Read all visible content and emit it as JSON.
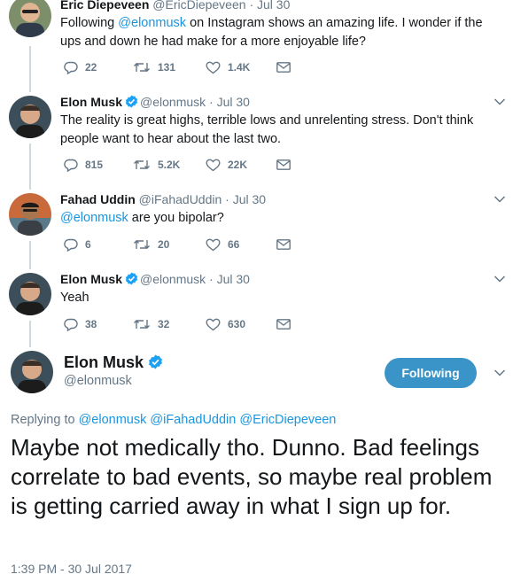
{
  "tweets": [
    {
      "name": "Eric Diepeveen",
      "handle": "@EricDiepeveen",
      "sep": "·",
      "date": "Jul 30",
      "text_before": "Following ",
      "text_mention": "@elonmusk",
      "text_after": " on Instagram shows an amazing life. I wonder if the ups and down he had make for a more enjoyable life?",
      "replies": "22",
      "retweets": "131",
      "likes": "1.4K"
    },
    {
      "name": "Elon Musk",
      "handle": "@elonmusk",
      "sep": "·",
      "date": "Jul 30",
      "text": "The reality is great highs, terrible lows and unrelenting stress. Don't think people want to hear about the last two.",
      "replies": "815",
      "retweets": "5.2K",
      "likes": "22K"
    },
    {
      "name": "Fahad Uddin",
      "handle": "@iFahadUddin",
      "sep": "·",
      "date": "Jul 30",
      "text_mention": "@elonmusk",
      "text_after": " are you bipolar?",
      "replies": "6",
      "retweets": "20",
      "likes": "66"
    },
    {
      "name": "Elon Musk",
      "handle": "@elonmusk",
      "sep": "·",
      "date": "Jul 30",
      "text": "Yeah",
      "replies": "38",
      "retweets": "32",
      "likes": "630"
    }
  ],
  "main_tweet": {
    "name": "Elon Musk",
    "handle": "@elonmusk",
    "follow_label": "Following",
    "replying_prefix": "Replying to ",
    "replying_mentions": "@elonmusk @iFahadUddin @EricDiepeveen",
    "text": "Maybe not medically tho. Dunno. Bad feelings correlate to bad events, so maybe real problem is getting carried away in what I sign up for.",
    "timestamp": "1:39 PM - 30 Jul 2017"
  },
  "colors": {
    "link": "#1b95e0",
    "muted": "#657786",
    "follow_button": "#3a94c8",
    "verified": "#1da1f2"
  }
}
